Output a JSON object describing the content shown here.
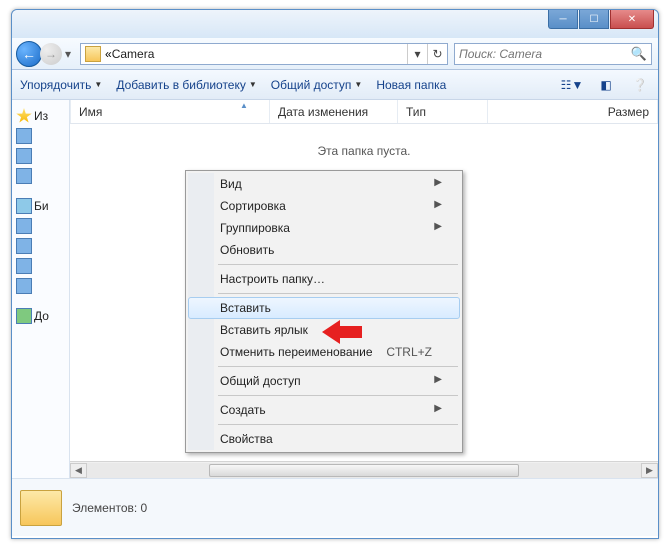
{
  "address": {
    "prefix": "« ",
    "folder": "Camera"
  },
  "search": {
    "placeholder": "Поиск: Camera"
  },
  "toolbar": {
    "organize": "Упорядочить",
    "add_library": "Добавить в библиотеку",
    "share": "Общий доступ",
    "new_folder": "Новая папка"
  },
  "columns": {
    "name": "Имя",
    "date": "Дата изменения",
    "type": "Тип",
    "size": "Размер"
  },
  "empty": "Эта папка пуста.",
  "sidebar": {
    "fav": "Из",
    "lib": "Би",
    "home": "До"
  },
  "status": {
    "label": "Элементов: 0"
  },
  "context": {
    "view": "Вид",
    "sort": "Сортировка",
    "group": "Группировка",
    "refresh": "Обновить",
    "customize": "Настроить папку…",
    "paste": "Вставить",
    "paste_shortcut": "Вставить ярлык",
    "undo_rename": "Отменить переименование",
    "undo_key": "CTRL+Z",
    "share": "Общий доступ",
    "new": "Создать",
    "properties": "Свойства"
  }
}
